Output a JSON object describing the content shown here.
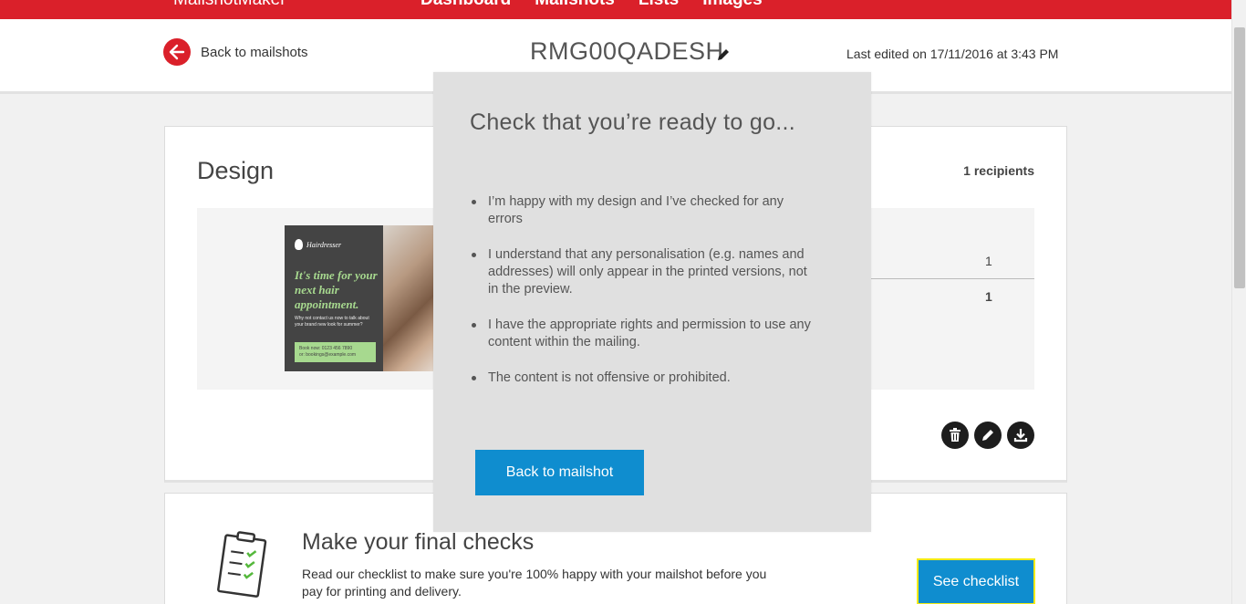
{
  "topbar": {
    "brand": "MailshotMaker",
    "nav": [
      "Dashboard",
      "Mailshots",
      "Lists",
      "Images"
    ]
  },
  "header": {
    "back_label": "Back to mailshots",
    "mailshot_name": "RMG00QADESH",
    "last_edited": "Last edited on 17/11/2016 at 3:43 PM"
  },
  "design": {
    "title": "Design",
    "recipients": "1 recipients",
    "preview": {
      "brand": "Hairdresser",
      "headline": "It's time for your next hair appointment.",
      "subtext": "Why not contact us now to talk about your brand new look for summer?",
      "book_line1": "Book now: 0123 456 7890",
      "book_line2": "or: bookings@example.com"
    },
    "table_value_1": "1",
    "table_value_2": "1"
  },
  "checks": {
    "title": "Make your final checks",
    "text": "Read our checklist to make sure you're 100% happy with your mailshot before you pay for printing and delivery.",
    "button_label": "See checklist"
  },
  "modal": {
    "title": "Check that you’re ready to go...",
    "items": [
      "I’m happy with my design and I’ve checked for any errors",
      "I understand that any personalisation (e.g. names and addresses) will only appear in the printed versions, not in the preview.",
      "I have the appropriate rights and permission to use any content within the mailing.",
      "The content is not offensive or prohibited."
    ],
    "button_label": "Back to mailshot"
  },
  "colors": {
    "brand_red": "#da202a",
    "button_blue": "#0f8dcf",
    "focus_yellow": "#f2ea12"
  }
}
